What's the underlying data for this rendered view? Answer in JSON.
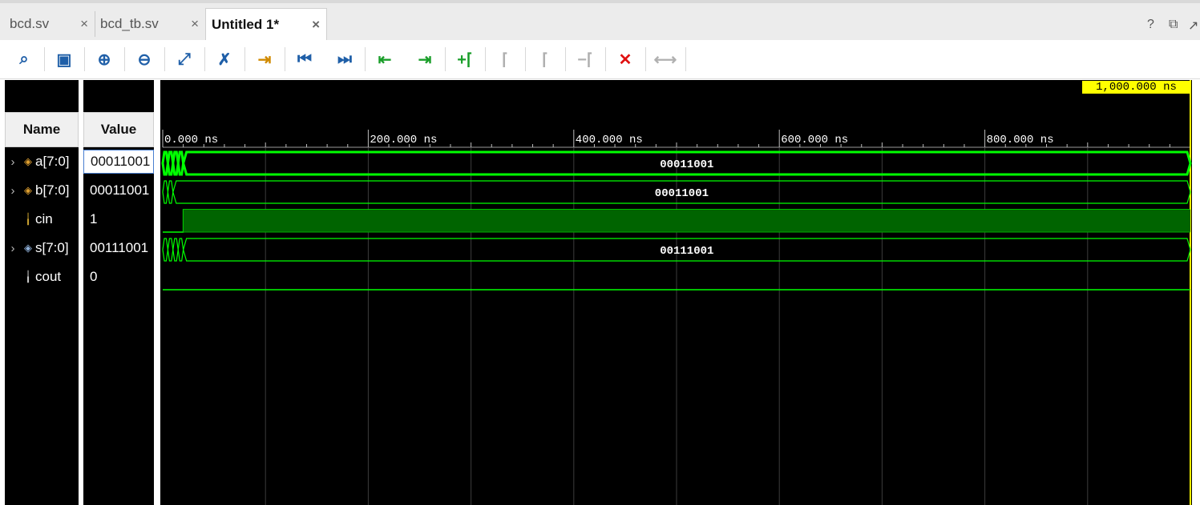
{
  "tabs": [
    {
      "label": "bcd.sv",
      "close": "×",
      "active": false
    },
    {
      "label": "bcd_tb.sv",
      "close": "×",
      "active": false
    },
    {
      "label": "Untitled 1*",
      "close": "×",
      "active": true
    }
  ],
  "window_controls": {
    "help": "?",
    "restore": "⧉",
    "popout": "↗"
  },
  "toolbar": {
    "buttons": [
      {
        "name": "search-button",
        "icon": "search-icon",
        "glyph": "⌕",
        "color": "#1f5fa8",
        "enabled": true
      },
      {
        "name": "save-button",
        "icon": "save-icon",
        "glyph": "▣",
        "color": "#1f5fa8",
        "enabled": true
      },
      {
        "name": "zoom-in-button",
        "icon": "zoom-in-icon",
        "glyph": "⊕",
        "color": "#1f5fa8",
        "enabled": true
      },
      {
        "name": "zoom-out-button",
        "icon": "zoom-out-icon",
        "glyph": "⊖",
        "color": "#1f5fa8",
        "enabled": true
      },
      {
        "name": "zoom-fit-button",
        "icon": "zoom-fit-icon",
        "glyph": "⤢",
        "color": "#1f5fa8",
        "enabled": true
      },
      {
        "name": "go-to-cursor-button",
        "icon": "cursor-icon",
        "glyph": "✗",
        "color": "#1f5fa8",
        "enabled": true
      },
      {
        "name": "previous-transition-button",
        "icon": "prev-transition-icon",
        "glyph": "⇥",
        "color": "#d08a00",
        "enabled": true
      },
      {
        "name": "go-to-start-button",
        "icon": "go-to-start-icon",
        "glyph": "⏮",
        "color": "#1f5fa8",
        "enabled": true
      },
      {
        "name": "go-to-end-button",
        "icon": "go-to-end-icon",
        "glyph": "⏭",
        "color": "#1f5fa8",
        "enabled": true
      },
      {
        "name": "previous-edge-button",
        "icon": "previous-edge-icon",
        "glyph": "⇤",
        "color": "#1a9e2a",
        "enabled": true
      },
      {
        "name": "next-edge-button",
        "icon": "next-edge-icon",
        "glyph": "⇥",
        "color": "#1a9e2a",
        "enabled": true
      },
      {
        "name": "add-marker-button",
        "icon": "add-marker-icon",
        "glyph": "+⌈",
        "color": "#1a9e2a",
        "enabled": true
      },
      {
        "name": "previous-marker-button",
        "icon": "previous-marker-icon",
        "glyph": "⌈",
        "color": "#b0b0b0",
        "enabled": false
      },
      {
        "name": "next-marker-button",
        "icon": "next-marker-icon",
        "glyph": "⌈",
        "color": "#b0b0b0",
        "enabled": false
      },
      {
        "name": "delete-marker-button",
        "icon": "delete-marker-icon",
        "glyph": "−⌈",
        "color": "#b0b0b0",
        "enabled": false
      },
      {
        "name": "delete-all-markers-button",
        "icon": "delete-icon",
        "glyph": "✕",
        "color": "#e01010",
        "enabled": true
      },
      {
        "name": "swap-cursors-button",
        "icon": "swap-cursors-icon",
        "glyph": "⟷",
        "color": "#b0b0b0",
        "enabled": false
      }
    ],
    "settings_icon": "⚙"
  },
  "headers": {
    "name": "Name",
    "value": "Value"
  },
  "signals": [
    {
      "name": "a[7:0]",
      "value": "00011001",
      "icon": "bus-input-icon",
      "expandable": true,
      "selected": true
    },
    {
      "name": "b[7:0]",
      "value": "00011001",
      "icon": "bus-input-icon",
      "expandable": true,
      "selected": false
    },
    {
      "name": "cin",
      "value": "1",
      "icon": "bit-input-icon",
      "expandable": false,
      "selected": false
    },
    {
      "name": "s[7:0]",
      "value": "00111001",
      "icon": "bus-output-icon",
      "expandable": true,
      "selected": false
    },
    {
      "name": "cout",
      "value": "0",
      "icon": "bit-output-icon",
      "expandable": false,
      "selected": false
    }
  ],
  "timeline": {
    "cursor_label": "1,000.000 ns",
    "ticks": [
      "0.000 ns",
      "200.000 ns",
      "400.000 ns",
      "600.000 ns",
      "800.000 ns"
    ],
    "tick_times_ns": [
      0,
      200,
      400,
      600,
      800
    ],
    "range_ns": [
      0,
      1000
    ]
  },
  "waveforms": [
    {
      "signal": "a[7:0]",
      "type": "bus",
      "final_value": "00011001",
      "transitions_ns": [
        5,
        10,
        15,
        20
      ],
      "highlight": true
    },
    {
      "signal": "b[7:0]",
      "type": "bus",
      "final_value": "00011001",
      "transitions_ns": [
        5,
        10
      ],
      "highlight": false
    },
    {
      "signal": "cin",
      "type": "bit",
      "initial": 0,
      "rise_ns": 20,
      "final": 1
    },
    {
      "signal": "s[7:0]",
      "type": "bus",
      "final_value": "00111001",
      "transitions_ns": [
        5,
        10,
        15,
        20
      ],
      "highlight": false
    },
    {
      "signal": "cout",
      "type": "bit",
      "initial": 0,
      "final": 0
    }
  ],
  "colors": {
    "wave": "#00ff00",
    "high_fill": "#006400",
    "grid": "#3a3a3a",
    "cursor": "#ffff00",
    "text": "#ffffff"
  }
}
